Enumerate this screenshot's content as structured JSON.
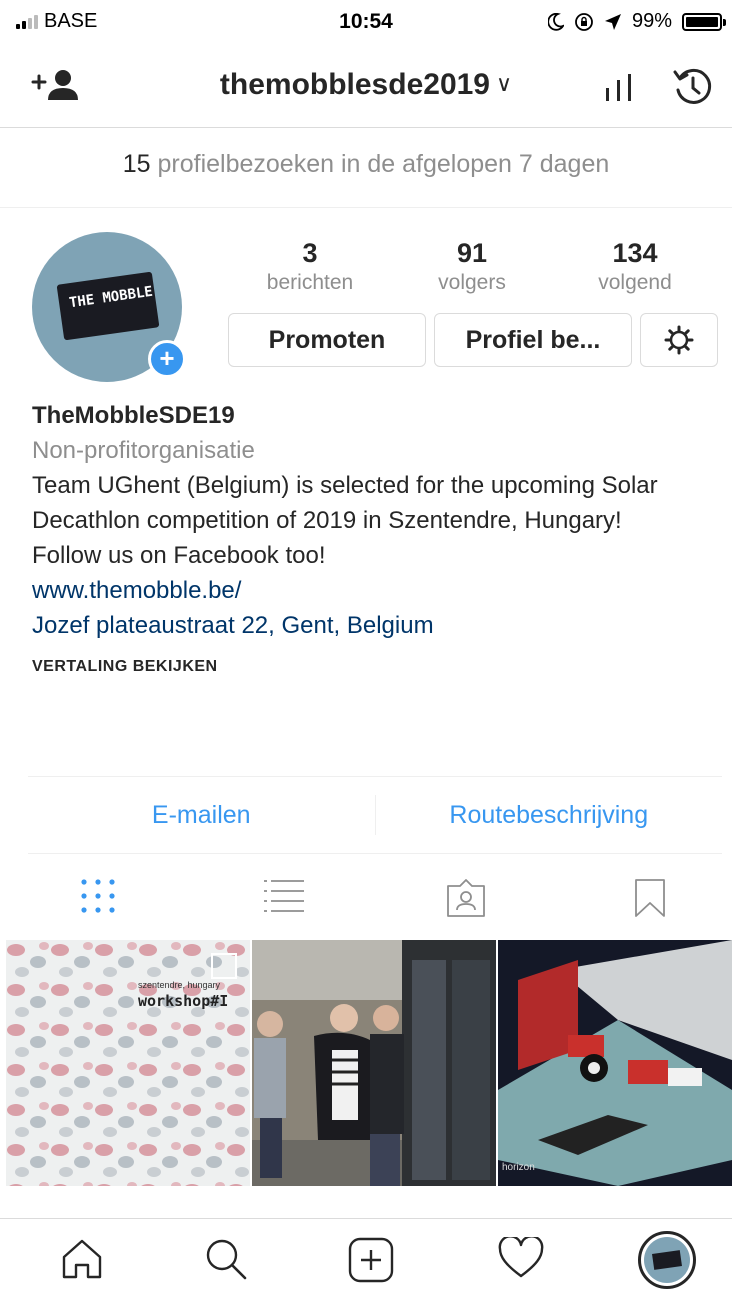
{
  "status_bar": {
    "carrier": "BASE",
    "time": "10:54",
    "battery": "99%"
  },
  "header": {
    "username": "themobblesde2019",
    "dropdown_chevron": "∨",
    "icons": [
      "add-person-icon",
      "insights-icon",
      "archive-icon"
    ]
  },
  "visits_banner": {
    "count": "15",
    "text": "profielbezoeken in de afgelopen 7 dagen"
  },
  "stats": [
    {
      "value": "3",
      "label": "berichten"
    },
    {
      "value": "91",
      "label": "volgers"
    },
    {
      "value": "134",
      "label": "volgend"
    }
  ],
  "actions": {
    "promote": "Promoten",
    "edit_profile": "Profiel be..."
  },
  "bio": {
    "name": "TheMobbleSDE19",
    "category": "Non-profitorganisatie",
    "description": "Team UGhent (Belgium) is selected for the upcoming Solar Decathlon competition of 2019 in Szentendre, Hungary!",
    "follow_line": "Follow us on Facebook too!",
    "website": "www.themobble.be/",
    "address": "Jozef plateaustraat 22, Gent, Belgium",
    "translate": "VERTALING BEKIJKEN",
    "avatar_text": "THE MOBBLE"
  },
  "contact": {
    "email": "E-mailen",
    "directions": "Routebeschrijving"
  },
  "colors": {
    "accent": "#3897f0",
    "link": "#003569",
    "secondary_text": "#8e8e8e"
  },
  "posts": [
    {
      "overlay_small": "szentendre, hungary",
      "overlay_title": "workshop#I"
    },
    {
      "overlay_small": "",
      "overlay_title": ""
    },
    {
      "overlay_small": "horizon",
      "overlay_title": ""
    }
  ]
}
